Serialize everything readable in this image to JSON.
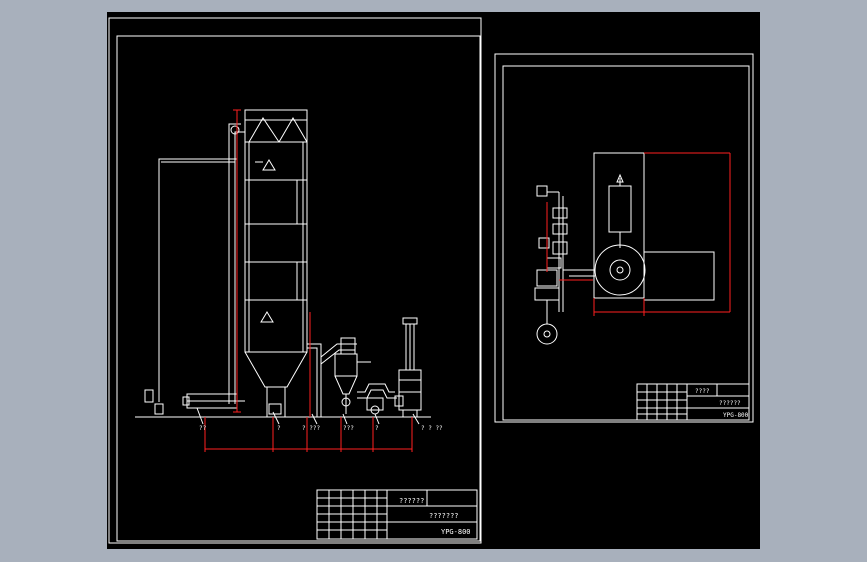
{
  "colors": {
    "background": "#a8b0bc",
    "canvas": "#000000",
    "line": "#ffffff",
    "dimension": "#ff2020"
  },
  "sheet_left": {
    "title_block": {
      "name": "??????",
      "company": "???????",
      "drawing_no": "YPG-800"
    },
    "callouts": [
      "??",
      "?",
      "? ???",
      "???",
      "?",
      "? ? ??"
    ]
  },
  "sheet_right": {
    "title_block": {
      "name": "????",
      "company": "??????",
      "drawing_no": "YPG-800"
    }
  }
}
